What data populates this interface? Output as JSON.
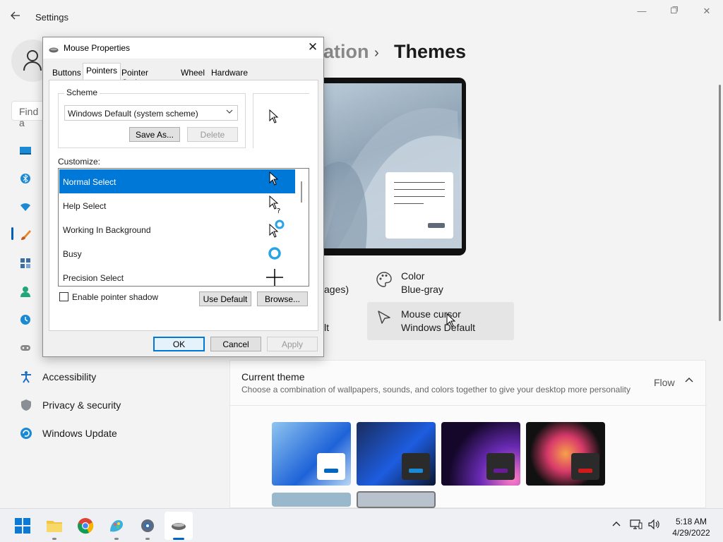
{
  "settings": {
    "app_title": "Settings",
    "search_placeholder": "Find a",
    "breadcrumb": {
      "parent_partial": "ation",
      "separator": "›",
      "current": "Themes"
    },
    "nav_bottom": [
      {
        "label": "Accessibility",
        "icon": "accessibility-icon"
      },
      {
        "label": "Privacy & security",
        "icon": "shield-icon"
      },
      {
        "label": "Windows Update",
        "icon": "update-icon"
      }
    ],
    "options": {
      "color": {
        "title": "Color",
        "value": "Blue-gray"
      },
      "mouse_cursor": {
        "title": "Mouse cursor",
        "value": "Windows Default"
      },
      "background_partial": "ages)",
      "sound_partial": "lt"
    },
    "current_theme": {
      "title": "Current theme",
      "description": "Choose a combination of wallpapers, sounds, and colors together to give your desktop more personality",
      "value": "Flow"
    }
  },
  "dialog": {
    "title": "Mouse Properties",
    "tabs": [
      "Buttons",
      "Pointers",
      "Pointer Options",
      "Wheel",
      "Hardware"
    ],
    "active_tab": "Pointers",
    "scheme_label": "Scheme",
    "scheme_value": "Windows Default (system scheme)",
    "save_as": "Save As...",
    "delete": "Delete",
    "customize_label": "Customize:",
    "pointers": [
      "Normal Select",
      "Help Select",
      "Working In Background",
      "Busy",
      "Precision Select"
    ],
    "enable_shadow": "Enable pointer shadow",
    "use_default": "Use Default",
    "browse": "Browse...",
    "ok": "OK",
    "cancel": "Cancel",
    "apply": "Apply"
  },
  "taskbar": {
    "time": "5:18 AM",
    "date": "4/29/2022"
  },
  "colors": {
    "accent": "#0078d7",
    "settings_accent": "#005fb8"
  }
}
